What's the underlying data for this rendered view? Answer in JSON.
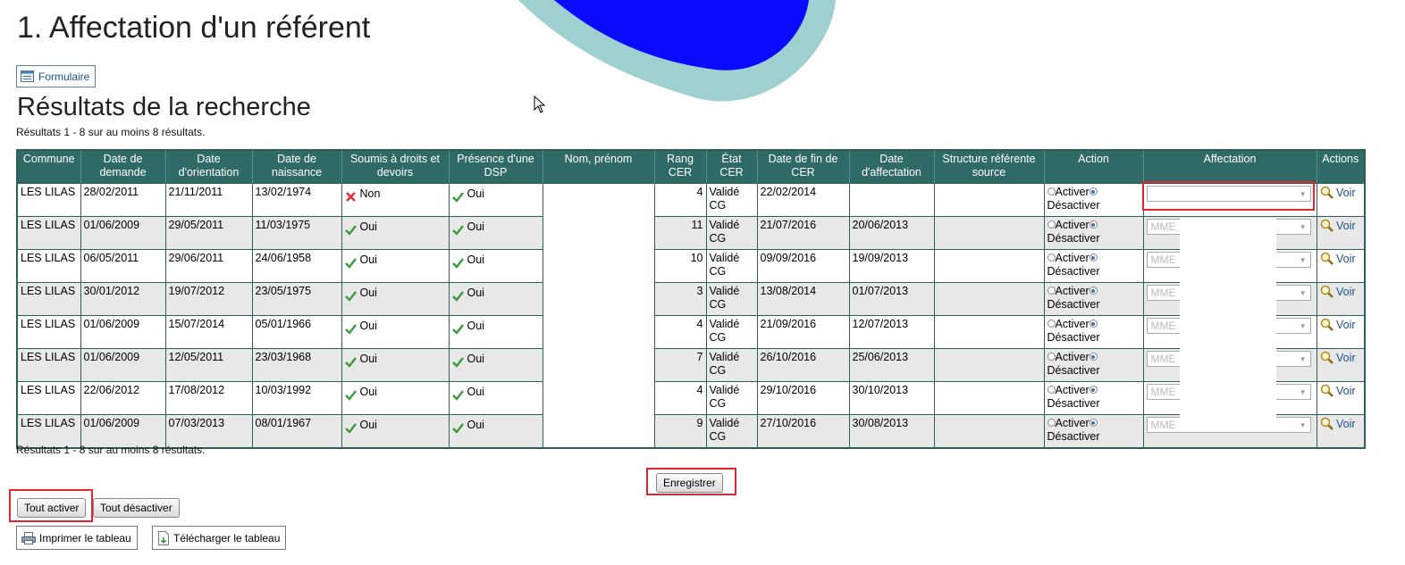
{
  "page": {
    "title": "1. Affectation d'un référent",
    "form_button": "Formulaire",
    "results_heading": "Résultats de la recherche",
    "count_top": "Résultats 1 - 8 sur au moins 8 résultats.",
    "count_bottom": "Résultats 1 - 8 sur au moins 8 résultats."
  },
  "table": {
    "headers": [
      "Commune",
      "Date de demande",
      "Date d'orientation",
      "Date de naissance",
      "Soumis à droits et devoirs",
      "Présence d'une DSP",
      "Nom, prénom",
      "Rang CER",
      "État CER",
      "Date de fin de CER",
      "Date d'affectation",
      "Structure référente source",
      "Action",
      "Affectation",
      "Actions"
    ],
    "rows": [
      {
        "commune": "LES LILAS",
        "demande": "28/02/2011",
        "orientation": "21/11/2011",
        "naissance": "13/02/1974",
        "soumis": "Non",
        "soumis_ok": false,
        "dsp": "Oui",
        "rang": "4",
        "etat": "Validé CG",
        "fin_cer": "22/02/2014",
        "affectation_date": "",
        "activer": "Activer",
        "desactiver": "Désactiver",
        "affectation": "",
        "voir": "Voir"
      },
      {
        "commune": "LES LILAS",
        "demande": "01/06/2009",
        "orientation": "29/05/2011",
        "naissance": "11/03/1975",
        "soumis": "Oui",
        "soumis_ok": true,
        "dsp": "Oui",
        "rang": "11",
        "etat": "Validé CG",
        "fin_cer": "21/07/2016",
        "affectation_date": "20/06/2013",
        "activer": "Activer",
        "desactiver": "Désactiver",
        "affectation": "MME",
        "voir": "Voir"
      },
      {
        "commune": "LES LILAS",
        "demande": "06/05/2011",
        "orientation": "29/06/2011",
        "naissance": "24/06/1958",
        "soumis": "Oui",
        "soumis_ok": true,
        "dsp": "Oui",
        "rang": "10",
        "etat": "Validé CG",
        "fin_cer": "09/09/2016",
        "affectation_date": "19/09/2013",
        "activer": "Activer",
        "desactiver": "Désactiver",
        "affectation": "MME",
        "voir": "Voir"
      },
      {
        "commune": "LES LILAS",
        "demande": "30/01/2012",
        "orientation": "19/07/2012",
        "naissance": "23/05/1975",
        "soumis": "Oui",
        "soumis_ok": true,
        "dsp": "Oui",
        "rang": "3",
        "etat": "Validé CG",
        "fin_cer": "13/08/2014",
        "affectation_date": "01/07/2013",
        "activer": "Activer",
        "desactiver": "Désactiver",
        "affectation": "MME",
        "voir": "Voir"
      },
      {
        "commune": "LES LILAS",
        "demande": "01/06/2009",
        "orientation": "15/07/2014",
        "naissance": "05/01/1966",
        "soumis": "Oui",
        "soumis_ok": true,
        "dsp": "Oui",
        "rang": "4",
        "etat": "Validé CG",
        "fin_cer": "21/09/2016",
        "affectation_date": "12/07/2013",
        "activer": "Activer",
        "desactiver": "Désactiver",
        "affectation": "MME",
        "voir": "Voir"
      },
      {
        "commune": "LES LILAS",
        "demande": "01/06/2009",
        "orientation": "12/05/2011",
        "naissance": "23/03/1968",
        "soumis": "Oui",
        "soumis_ok": true,
        "dsp": "Oui",
        "rang": "7",
        "etat": "Validé CG",
        "fin_cer": "26/10/2016",
        "affectation_date": "25/06/2013",
        "activer": "Activer",
        "desactiver": "Désactiver",
        "affectation": "MME",
        "voir": "Voir"
      },
      {
        "commune": "LES LILAS",
        "demande": "22/06/2012",
        "orientation": "17/08/2012",
        "naissance": "10/03/1992",
        "soumis": "Oui",
        "soumis_ok": true,
        "dsp": "Oui",
        "rang": "4",
        "etat": "Validé CG",
        "fin_cer": "29/10/2016",
        "affectation_date": "30/10/2013",
        "activer": "Activer",
        "desactiver": "Désactiver",
        "affectation": "MME",
        "voir": "Voir"
      },
      {
        "commune": "LES LILAS",
        "demande": "01/06/2009",
        "orientation": "07/03/2013",
        "naissance": "08/01/1967",
        "soumis": "Oui",
        "soumis_ok": true,
        "dsp": "Oui",
        "rang": "9",
        "etat": "Validé CG",
        "fin_cer": "27/10/2016",
        "affectation_date": "30/08/2013",
        "activer": "Activer",
        "desactiver": "Désactiver",
        "affectation": "MME",
        "voir": "Voir"
      }
    ]
  },
  "buttons": {
    "save": "Enregistrer",
    "activate_all": "Tout activer",
    "deactivate_all": "Tout désactiver",
    "print": "Imprimer le tableau",
    "download": "Télécharger le tableau"
  },
  "icons": {
    "ok": "check-icon",
    "no": "cross-icon",
    "view": "magnifier-icon",
    "form": "form-icon",
    "print": "printer-icon",
    "download": "download-file-icon"
  },
  "colors": {
    "header_bg": "#2f6a67",
    "highlight": "#e0252c",
    "blob_outer": "#9fd0d0",
    "blob_inner": "#0a0aff"
  }
}
